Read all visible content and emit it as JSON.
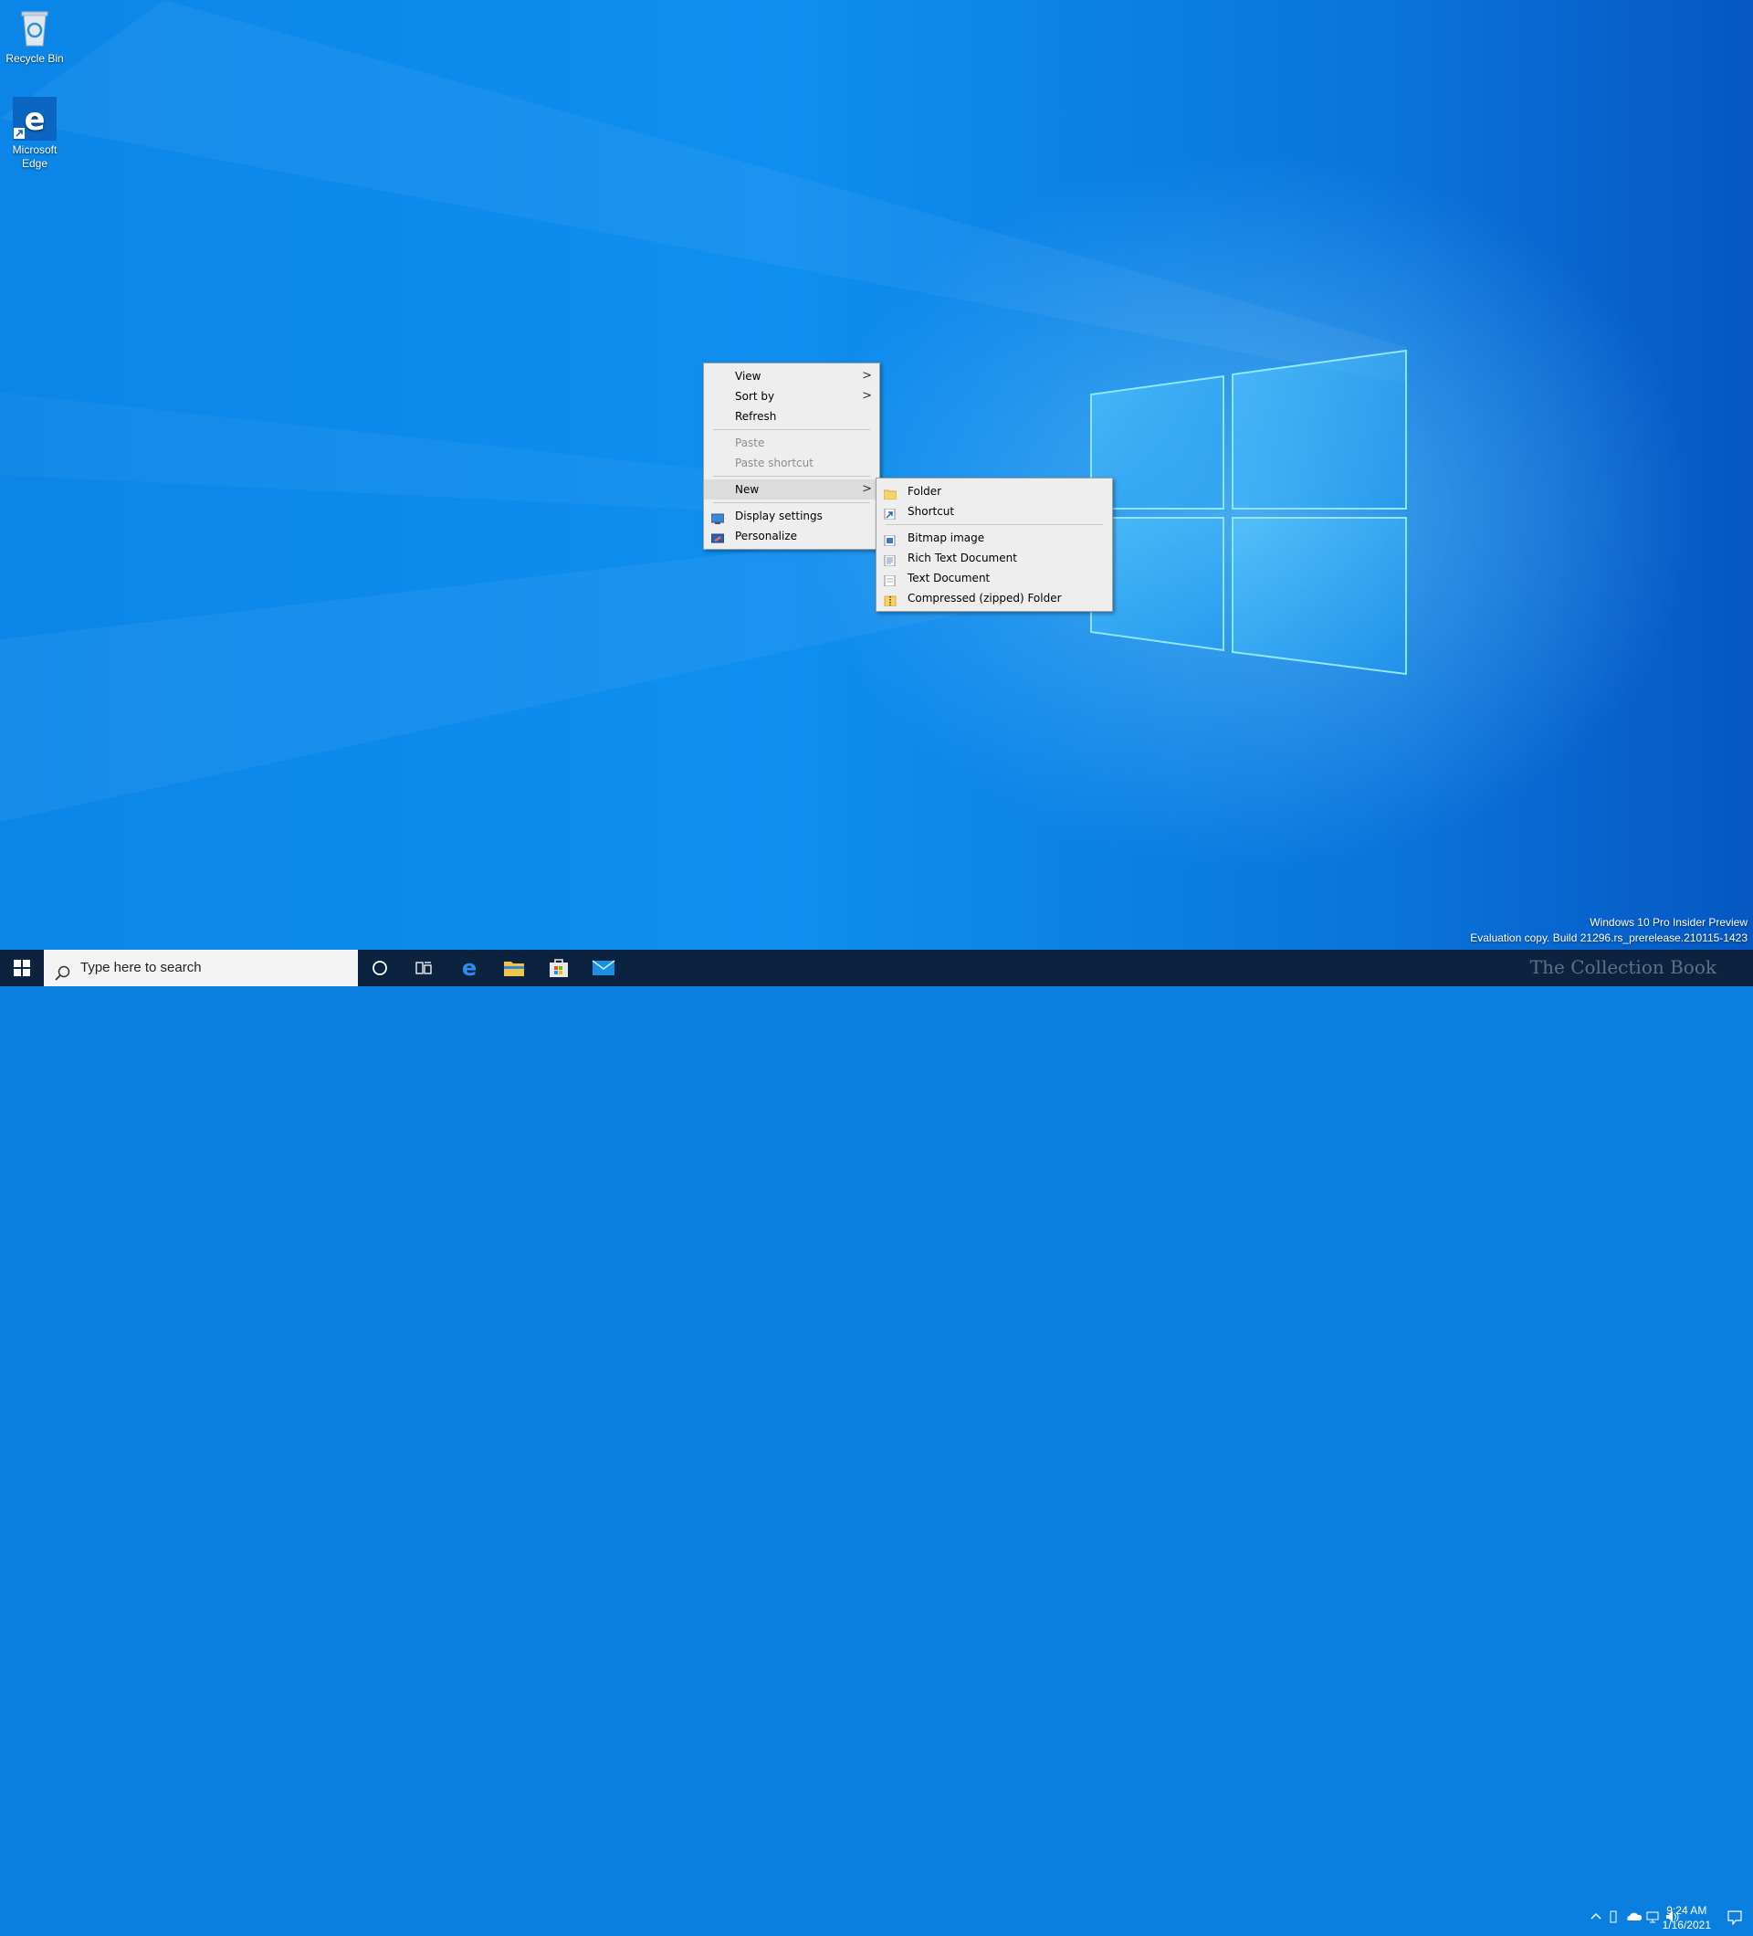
{
  "desktop": {
    "icons": [
      {
        "label": "Recycle Bin",
        "icon": "recycle-bin-icon"
      },
      {
        "label": "Microsoft Edge",
        "icon": "edge-icon"
      }
    ]
  },
  "context_menu": {
    "items": [
      {
        "label": "View",
        "has_submenu": true
      },
      {
        "label": "Sort by",
        "has_submenu": true
      },
      {
        "label": "Refresh"
      },
      {
        "label": "Paste",
        "disabled": true
      },
      {
        "label": "Paste shortcut",
        "disabled": true
      },
      {
        "label": "New",
        "has_submenu": true,
        "highlighted": true
      },
      {
        "label": "Display settings",
        "icon": "display-settings-icon"
      },
      {
        "label": "Personalize",
        "icon": "personalize-icon"
      }
    ],
    "arrow_glyph": ">"
  },
  "new_submenu": {
    "items": [
      {
        "label": "Folder",
        "icon": "folder-icon"
      },
      {
        "label": "Shortcut",
        "icon": "shortcut-icon"
      },
      {
        "label": "Bitmap image",
        "icon": "bitmap-icon"
      },
      {
        "label": "Rich Text Document",
        "icon": "rtf-document-icon"
      },
      {
        "label": "Text Document",
        "icon": "text-document-icon"
      },
      {
        "label": "Compressed (zipped) Folder",
        "icon": "zip-folder-icon"
      }
    ]
  },
  "taskbar": {
    "search_placeholder": "Type here to search",
    "pinned": [
      "edge-icon",
      "file-explorer-icon",
      "store-icon",
      "mail-icon"
    ],
    "clock_time": "9:24 AM",
    "clock_date": "1/16/2021"
  },
  "watermark": {
    "line1": "Windows 10 Pro Insider Preview",
    "line2": "Evaluation copy. Build 21296.rs_prerelease.210115-1423"
  },
  "brand_watermark": "The Collection Book",
  "colors": {
    "taskbar": "#0c2340",
    "menu_bg": "#eeeeee",
    "accent": "#0078d7"
  }
}
